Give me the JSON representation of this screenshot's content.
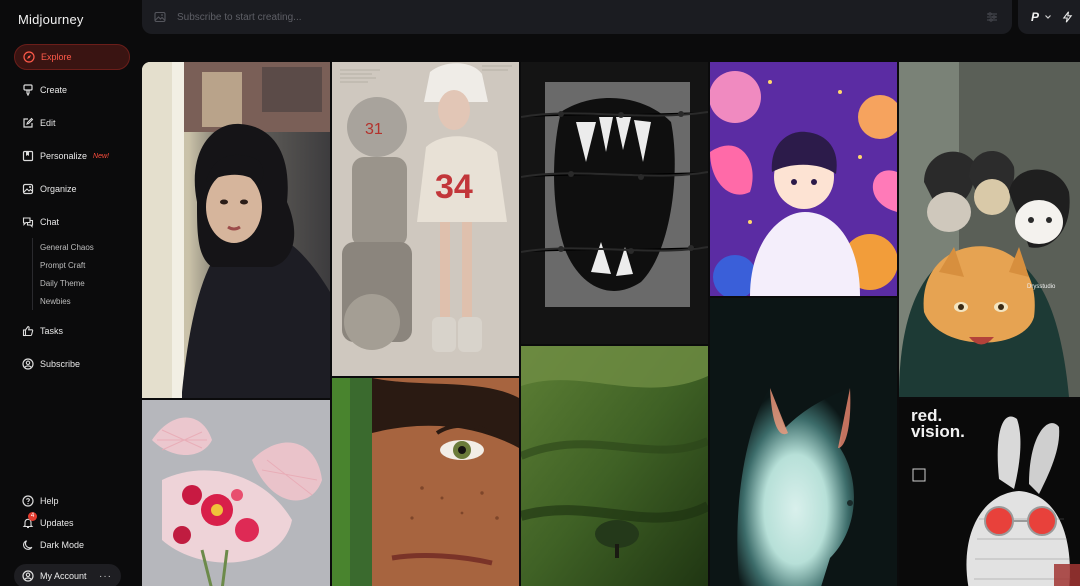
{
  "app": {
    "brand": "Midjourney"
  },
  "nav": {
    "explore": "Explore",
    "create": "Create",
    "edit": "Edit",
    "personalize": "Personalize",
    "personalize_badge": "New!",
    "organize": "Organize",
    "chat": "Chat",
    "chat_rooms": [
      "General Chaos",
      "Prompt Craft",
      "Daily Theme",
      "Newbies"
    ],
    "tasks": "Tasks",
    "subscribe": "Subscribe"
  },
  "bottom": {
    "help": "Help",
    "updates": "Updates",
    "updates_count": "4",
    "dark_mode": "Dark Mode",
    "account": "My Account",
    "account_more": "···"
  },
  "search": {
    "placeholder": "Subscribe to start creating..."
  },
  "profile": {
    "initial": "P"
  },
  "gallery": {
    "poster_title_line1": "red.",
    "poster_title_line2": "vision.",
    "sweater_number": "34",
    "hood_text": "Drysstudio"
  },
  "colors": {
    "accent": "#ff5a4a",
    "active_bg": "#3a1412",
    "sidebar_bg": "#0b0b0c",
    "topbar_bg": "#1b1c21"
  },
  "icons": {
    "explore": "compass-icon",
    "create": "brush-icon",
    "edit": "pencil-square-icon",
    "personalize": "bookmark-card-icon",
    "organize": "image-icon",
    "chat": "chat-bubbles-icon",
    "tasks": "thumbs-up-icon",
    "subscribe": "user-circle-icon",
    "help": "question-icon",
    "updates": "bell-icon",
    "dark_mode": "moon-icon"
  }
}
